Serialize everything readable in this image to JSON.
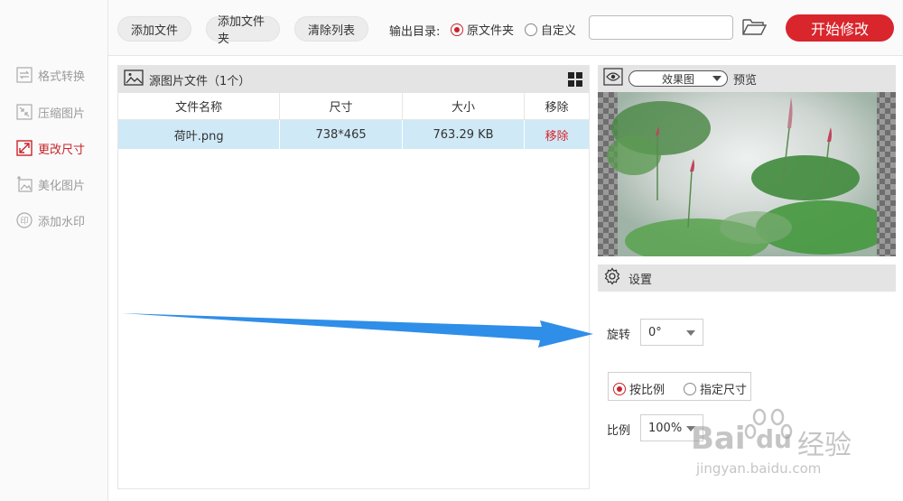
{
  "sidebar": {
    "items": [
      {
        "label": "格式转换",
        "icon": "convert-icon"
      },
      {
        "label": "压缩图片",
        "icon": "compress-icon"
      },
      {
        "label": "更改尺寸",
        "icon": "resize-icon",
        "active": true
      },
      {
        "label": "美化图片",
        "icon": "beautify-icon"
      },
      {
        "label": "添加水印",
        "icon": "watermark-icon"
      }
    ]
  },
  "toolbar": {
    "add_file": "添加文件",
    "add_folder": "添加文件夹",
    "clear_list": "清除列表",
    "output_dir_label": "输出目录:",
    "radio_original": "原文件夹",
    "radio_custom": "自定义",
    "path_value": "",
    "start_button": "开始修改"
  },
  "file_panel": {
    "title": "源图片文件（1个）",
    "columns": [
      "文件名称",
      "尺寸",
      "大小",
      "移除"
    ],
    "rows": [
      {
        "name": "荷叶.png",
        "size": "738*465",
        "filesize": "763.29 KB",
        "remove": "移除"
      }
    ]
  },
  "preview": {
    "mode": "效果图",
    "label": "预览"
  },
  "settings": {
    "title": "设置",
    "rotate_label": "旋转",
    "rotate_value": "0°",
    "mode_ratio": "按比例",
    "mode_size": "指定尺寸",
    "ratio_label": "比例",
    "ratio_value": "100%"
  },
  "watermark": {
    "brand": "Bai",
    "brand2": "du",
    "suffix": "经验",
    "url": "jingyan.baidu.com"
  },
  "colors": {
    "accent": "#d9252c",
    "selected_row": "#cfe9f7",
    "arrow": "#2f8ee8"
  }
}
